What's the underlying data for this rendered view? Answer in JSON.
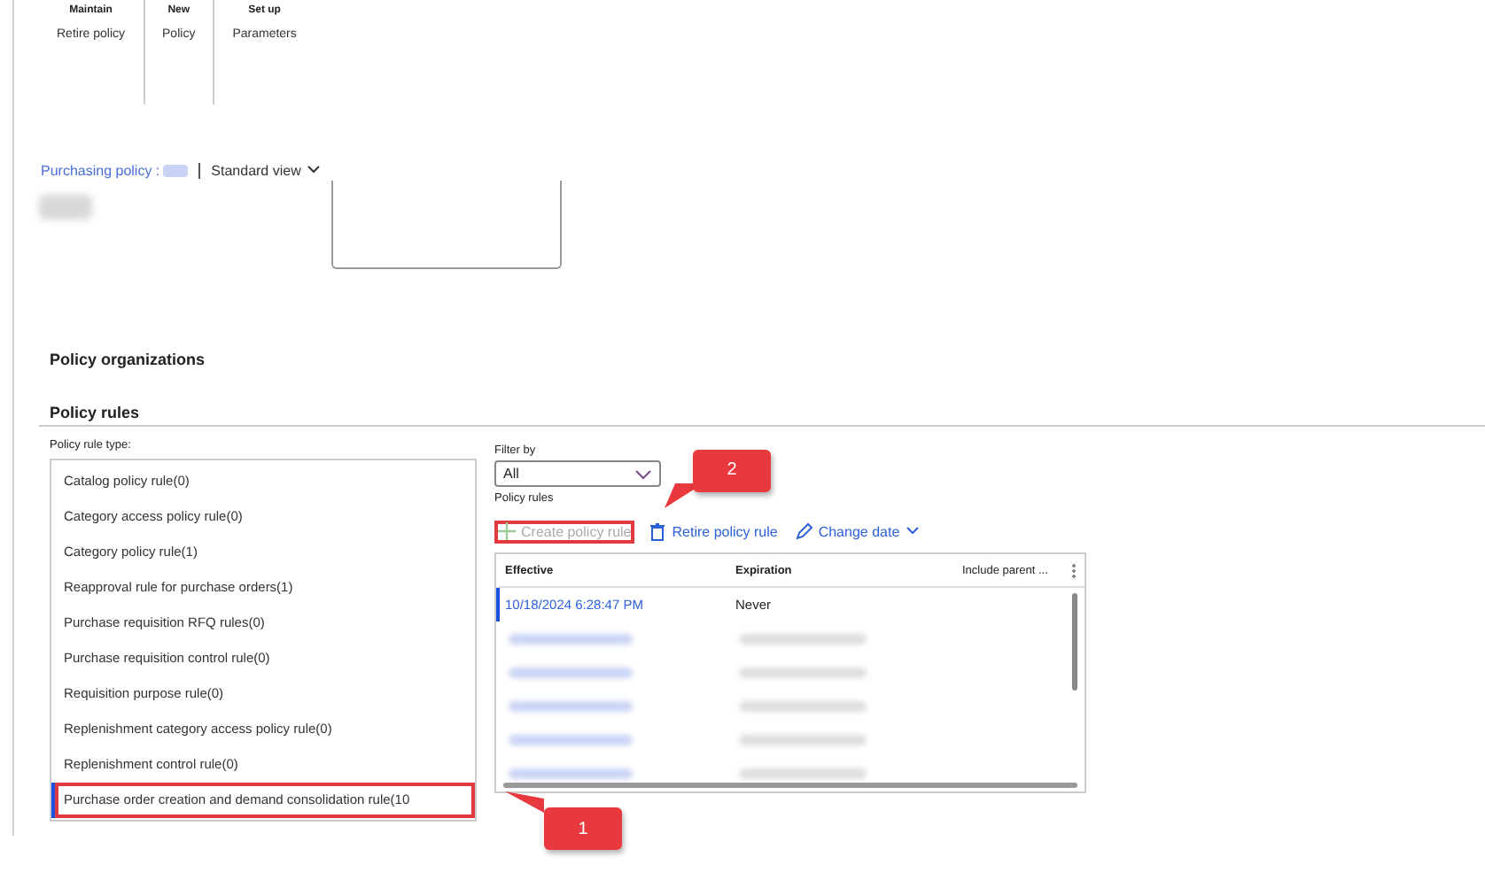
{
  "ribbon": {
    "groups": [
      {
        "title": "Maintain",
        "items": [
          "Retire policy"
        ]
      },
      {
        "title": "New",
        "items": [
          "Policy"
        ]
      },
      {
        "title": "Set up",
        "items": [
          "Parameters"
        ]
      }
    ]
  },
  "breadcrumb": {
    "link": "Purchasing policy :",
    "view": "Standard view"
  },
  "sections": [
    "Policy organizations",
    "Policy rules"
  ],
  "rule_types": {
    "label": "Policy rule type:",
    "items": [
      {
        "label": "Catalog policy rule(0)",
        "selected": false,
        "highlighted": false
      },
      {
        "label": "Category access policy rule(0)",
        "selected": false,
        "highlighted": false
      },
      {
        "label": "Category policy rule(1)",
        "selected": false,
        "highlighted": false
      },
      {
        "label": "Reapproval rule for purchase orders(1)",
        "selected": false,
        "highlighted": false
      },
      {
        "label": "Purchase requisition RFQ rules(0)",
        "selected": false,
        "highlighted": false
      },
      {
        "label": "Purchase requisition control rule(0)",
        "selected": false,
        "highlighted": false
      },
      {
        "label": "Requisition purpose rule(0)",
        "selected": false,
        "highlighted": false
      },
      {
        "label": "Replenishment category access policy rule(0)",
        "selected": false,
        "highlighted": false
      },
      {
        "label": "Replenishment control rule(0)",
        "selected": false,
        "highlighted": false
      },
      {
        "label": "Purchase order creation and demand consolidation rule(10",
        "selected": true,
        "highlighted": true
      }
    ]
  },
  "filter": {
    "label": "Filter by",
    "value": "All"
  },
  "rules": {
    "label": "Policy rules",
    "toolbar": [
      {
        "kind": "create",
        "label": "Create policy rule",
        "disabled": true,
        "highlighted": true
      },
      {
        "kind": "retire",
        "label": "Retire policy rule",
        "disabled": false,
        "highlighted": false
      },
      {
        "kind": "date",
        "label": "Change date",
        "disabled": false,
        "highlighted": false
      }
    ],
    "columns": [
      "Effective",
      "Expiration",
      "Include parent ..."
    ],
    "rows": [
      {
        "kind": "plain",
        "effective": "10/18/2024 6:28:47 PM",
        "expiration": "Never",
        "selected": true
      },
      {
        "kind": "redacted"
      },
      {
        "kind": "redacted"
      },
      {
        "kind": "redacted"
      },
      {
        "kind": "redacted"
      },
      {
        "kind": "redacted"
      }
    ]
  },
  "callouts": [
    {
      "label": "2",
      "kind": "toolbar"
    },
    {
      "label": "1",
      "kind": "rule-type"
    }
  ]
}
